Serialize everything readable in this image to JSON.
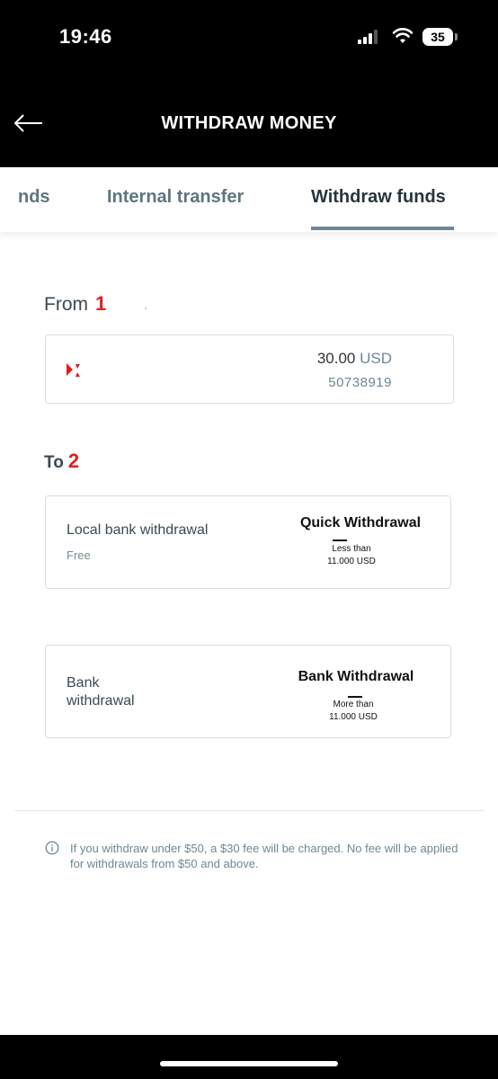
{
  "status_bar": {
    "time": "19:46",
    "battery": "35"
  },
  "header": {
    "title": "WITHDRAW MONEY"
  },
  "tabs": [
    {
      "label": "nds"
    },
    {
      "label": "Internal transfer"
    },
    {
      "label": "Withdraw funds",
      "active": true
    }
  ],
  "from": {
    "label": "From",
    "step": "1",
    "account": {
      "balance": "30.00",
      "currency": "USD",
      "number": "50738919"
    }
  },
  "to": {
    "label": "To",
    "step": "2",
    "methods": [
      {
        "name": "Local bank withdrawal",
        "fee": "Free",
        "type": "Quick Withdrawal",
        "limit_line1": "Less than",
        "limit_line2": "11.000 USD"
      },
      {
        "name_line1": "Bank",
        "name_line2": "withdrawal",
        "type": "Bank Withdrawal",
        "limit_line1": "More than",
        "limit_line2": "11.000 USD"
      }
    ]
  },
  "notice": {
    "text": "If you withdraw under $50, a $30 fee will be charged. No fee will be applied for withdrawals from $50 and above."
  },
  "colors": {
    "accent_red": "#e0201f",
    "muted_blue_gray": "#6d8894",
    "header_bg": "#000000"
  },
  "icons": {
    "back": "arrow-left-icon",
    "info": "info-circle-icon",
    "account_logo": "brand-logo-icon"
  }
}
